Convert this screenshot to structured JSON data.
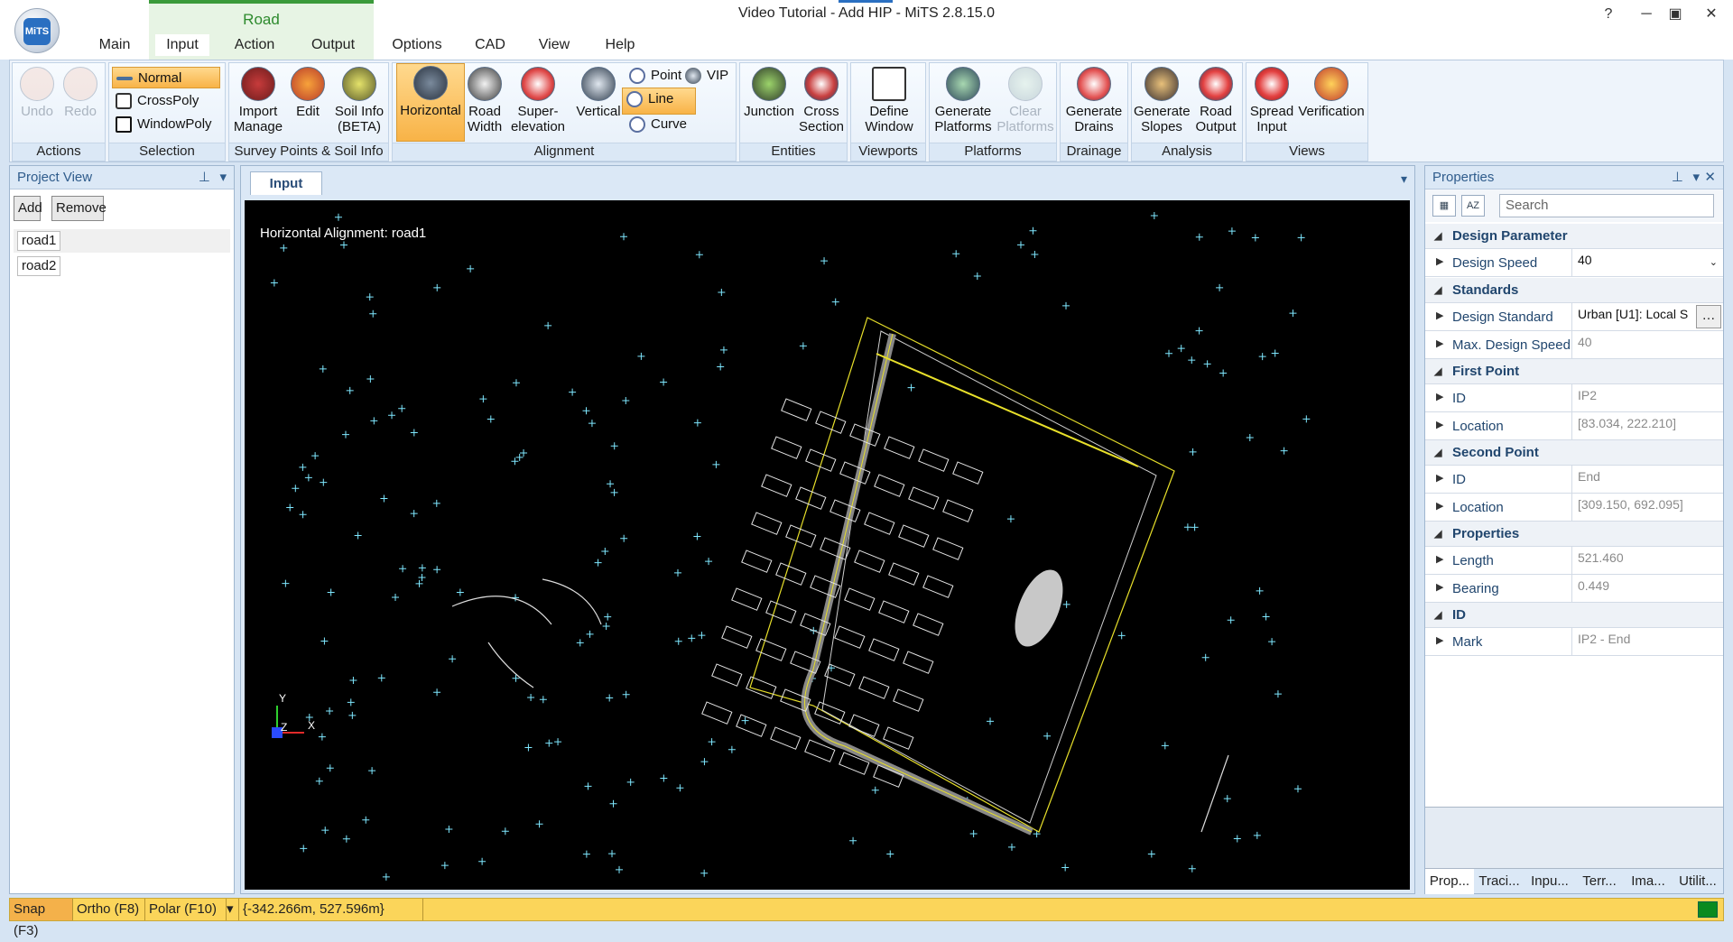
{
  "app": {
    "title": "Video Tutorial - Add HIP - MiTS 2.8.15.0",
    "logo_text": "MiTS"
  },
  "window_buttons": [
    "?",
    "─",
    "▣",
    "✕"
  ],
  "context_group": "Road",
  "tabs": [
    "Main",
    "Input",
    "Action",
    "Output",
    "Options",
    "CAD",
    "View",
    "Help"
  ],
  "ribbon": {
    "actions": {
      "label": "Actions",
      "undo": "Undo",
      "redo": "Redo"
    },
    "selection": {
      "label": "Selection",
      "normal": "Normal",
      "crosspoly": "CrossPoly",
      "windowpoly": "WindowPoly"
    },
    "survey": {
      "label": "Survey Points & Soil Info",
      "import1": "Import",
      "import2": "Manage",
      "edit": "Edit",
      "soil1": "Soil Info",
      "soil2": "(BETA)"
    },
    "alignment": {
      "label": "Alignment",
      "horizontal": "Horizontal",
      "road1": "Road",
      "road2": "Width",
      "super1": "Super-",
      "super2": "elevation",
      "vertical": "Vertical",
      "point": "Point",
      "line": "Line",
      "curve": "Curve",
      "vip": "VIP"
    },
    "entities": {
      "label": "Entities",
      "junction": "Junction",
      "cross1": "Cross",
      "cross2": "Section"
    },
    "viewports": {
      "label": "Viewports",
      "define1": "Define",
      "define2": "Window"
    },
    "platforms": {
      "label": "Platforms",
      "gen1": "Generate",
      "gen2": "Platforms",
      "clear1": "Clear",
      "clear2": "Platforms"
    },
    "drainage": {
      "label": "Drainage",
      "gen1": "Generate",
      "gen2": "Drains"
    },
    "analysis": {
      "label": "Analysis",
      "slopes1": "Generate",
      "slopes2": "Slopes",
      "out1": "Road",
      "out2": "Output"
    },
    "views": {
      "label": "Views",
      "spread1": "Spread",
      "spread2": "Input",
      "verif": "Verification"
    }
  },
  "project_view": {
    "title": "Project View",
    "pin": "📌",
    "add": "Add",
    "remove": "Remove",
    "roads": [
      "road1",
      "road2"
    ]
  },
  "document": {
    "tab": "Input",
    "canvas_title": "Horizontal Alignment: road1",
    "axis_y": "Y",
    "axis_z": "Z",
    "axis_x": "X"
  },
  "properties": {
    "title": "Properties",
    "search_placeholder": "Search",
    "categories": {
      "design_parameter": "Design Parameter",
      "standards": "Standards",
      "first_point": "First Point",
      "second_point": "Second Point",
      "properties": "Properties",
      "id": "ID"
    },
    "rows": {
      "design_speed": {
        "name": "Design Speed",
        "value": "40"
      },
      "design_standard": {
        "name": "Design Standard",
        "value": "Urban [U1]: Local S"
      },
      "max_design_speed": {
        "name": "Max. Design Speed",
        "value": "40"
      },
      "fp_id": {
        "name": "ID",
        "value": "IP2"
      },
      "fp_location": {
        "name": "Location",
        "value": "[83.034, 222.210]"
      },
      "sp_id": {
        "name": "ID",
        "value": "End"
      },
      "sp_location": {
        "name": "Location",
        "value": "[309.150, 692.095]"
      },
      "length": {
        "name": "Length",
        "value": "521.460"
      },
      "bearing": {
        "name": "Bearing",
        "value": "0.449"
      },
      "mark": {
        "name": "Mark",
        "value": "IP2 - End"
      }
    },
    "bottom_tabs": [
      "Prop...",
      "Traci...",
      "Inpu...",
      "Terr...",
      "Ima...",
      "Utilit..."
    ]
  },
  "statusbar": {
    "snap": "Snap (F3)",
    "ortho": "Ortho (F8)",
    "polar": "Polar (F10)",
    "coords": "{-342.266m, 527.596m}"
  },
  "colors": {
    "accent": "#2a6fc1",
    "highlight": "#e11d2a",
    "context_green": "#3a9a3a",
    "status_yellow": "#fbd55a",
    "survey_points": "#7fe8ff",
    "site_outline": "#e8e02a"
  }
}
